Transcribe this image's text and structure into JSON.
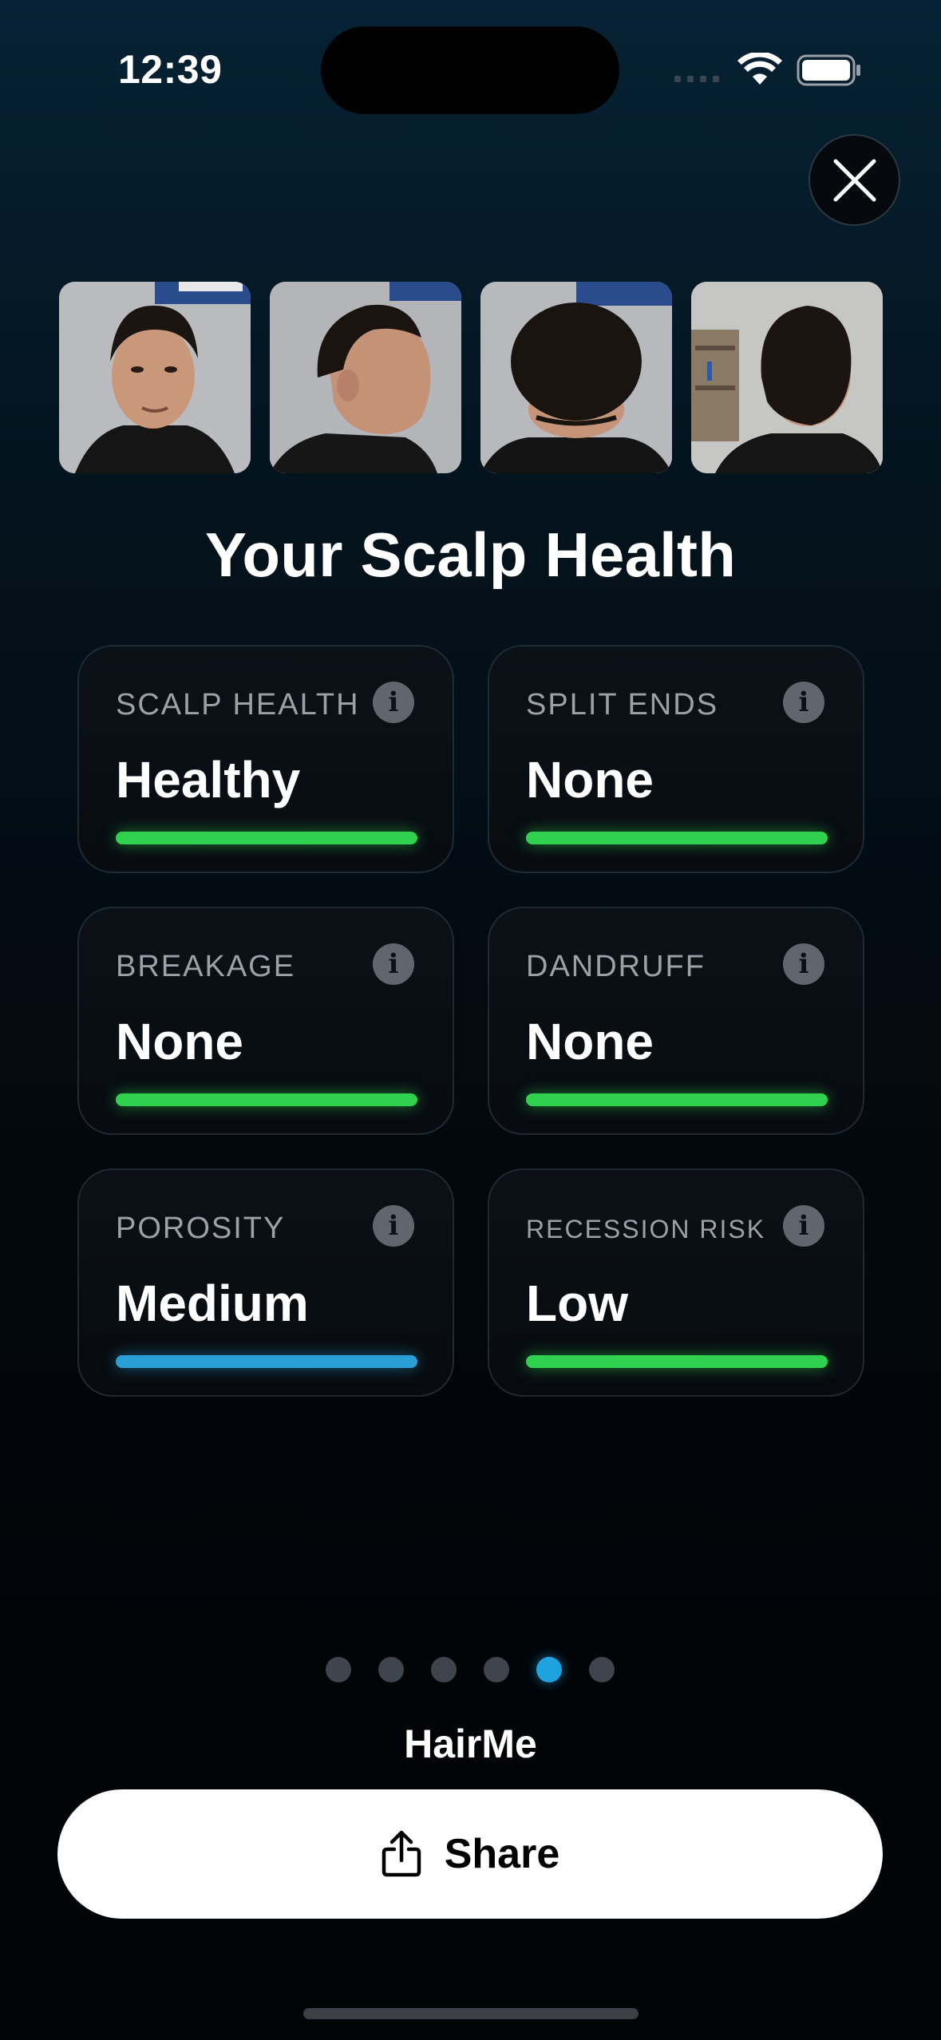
{
  "status_bar": {
    "time": "12:39"
  },
  "photos": [
    {
      "view": "front"
    },
    {
      "view": "side"
    },
    {
      "view": "top"
    },
    {
      "view": "back"
    }
  ],
  "title": "Your Scalp Health",
  "metrics": [
    {
      "label": "SCALP HEALTH",
      "value": "Healthy",
      "bar_color": "#2fd14f"
    },
    {
      "label": "SPLIT ENDS",
      "value": "None",
      "bar_color": "#2fd14f"
    },
    {
      "label": "BREAKAGE",
      "value": "None",
      "bar_color": "#2fd14f"
    },
    {
      "label": "DANDRUFF",
      "value": "None",
      "bar_color": "#2fd14f"
    },
    {
      "label": "POROSITY",
      "value": "Medium",
      "bar_color": "#2a9fd6"
    },
    {
      "label": "RECESSION RISK",
      "value": "Low",
      "bar_color": "#2fd14f"
    }
  ],
  "info_glyph": "i",
  "pager": {
    "total": 6,
    "active_index": 4
  },
  "brand": "HairMe",
  "share_button": {
    "label": "Share",
    "icon": "share-icon"
  },
  "colors": {
    "accent": "#1fa3df",
    "good": "#2fd14f",
    "neutral": "#2a9fd6"
  }
}
